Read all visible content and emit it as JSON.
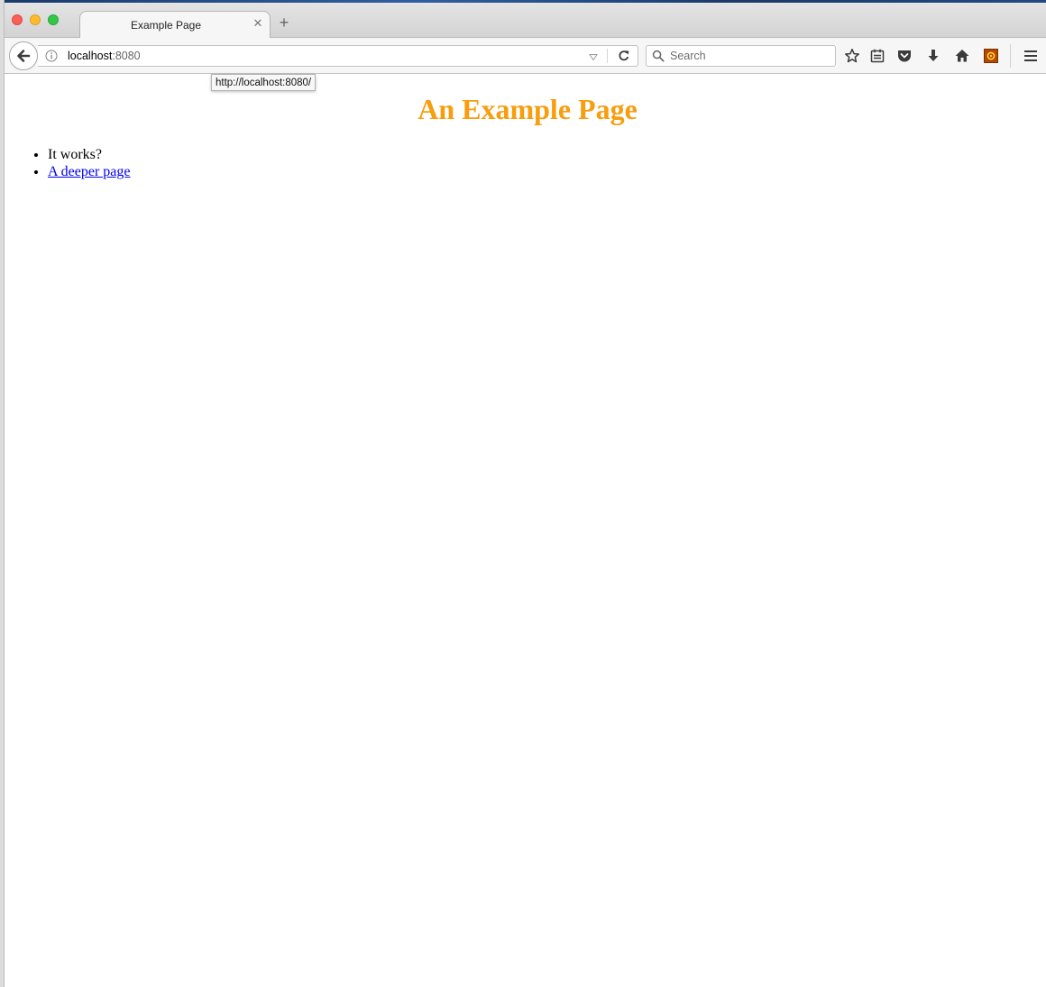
{
  "browser": {
    "tab": {
      "title": "Example Page",
      "close_icon": "close-icon"
    },
    "new_tab_icon": "plus-icon",
    "address_bar": {
      "host": "localhost",
      "port": ":8080",
      "info_icon": "info-icon",
      "dropmarker_icon": "history-dropdown-icon",
      "reload_icon": "reload-icon"
    },
    "search_bar": {
      "placeholder": "Search",
      "icon": "search-icon"
    },
    "toolbar_icons": [
      "bookmark-star-icon",
      "reading-list-icon",
      "pocket-icon",
      "download-icon",
      "home-icon",
      "extension-icon",
      "hamburger-menu-icon"
    ],
    "link_tooltip": "http://localhost:8080/"
  },
  "page": {
    "heading": "An Example Page",
    "heading_color": "#f89d0e",
    "list": [
      {
        "text": "It works?"
      },
      {
        "text": "A deeper page",
        "is_link": true
      }
    ],
    "link_color": "#0000ee"
  }
}
